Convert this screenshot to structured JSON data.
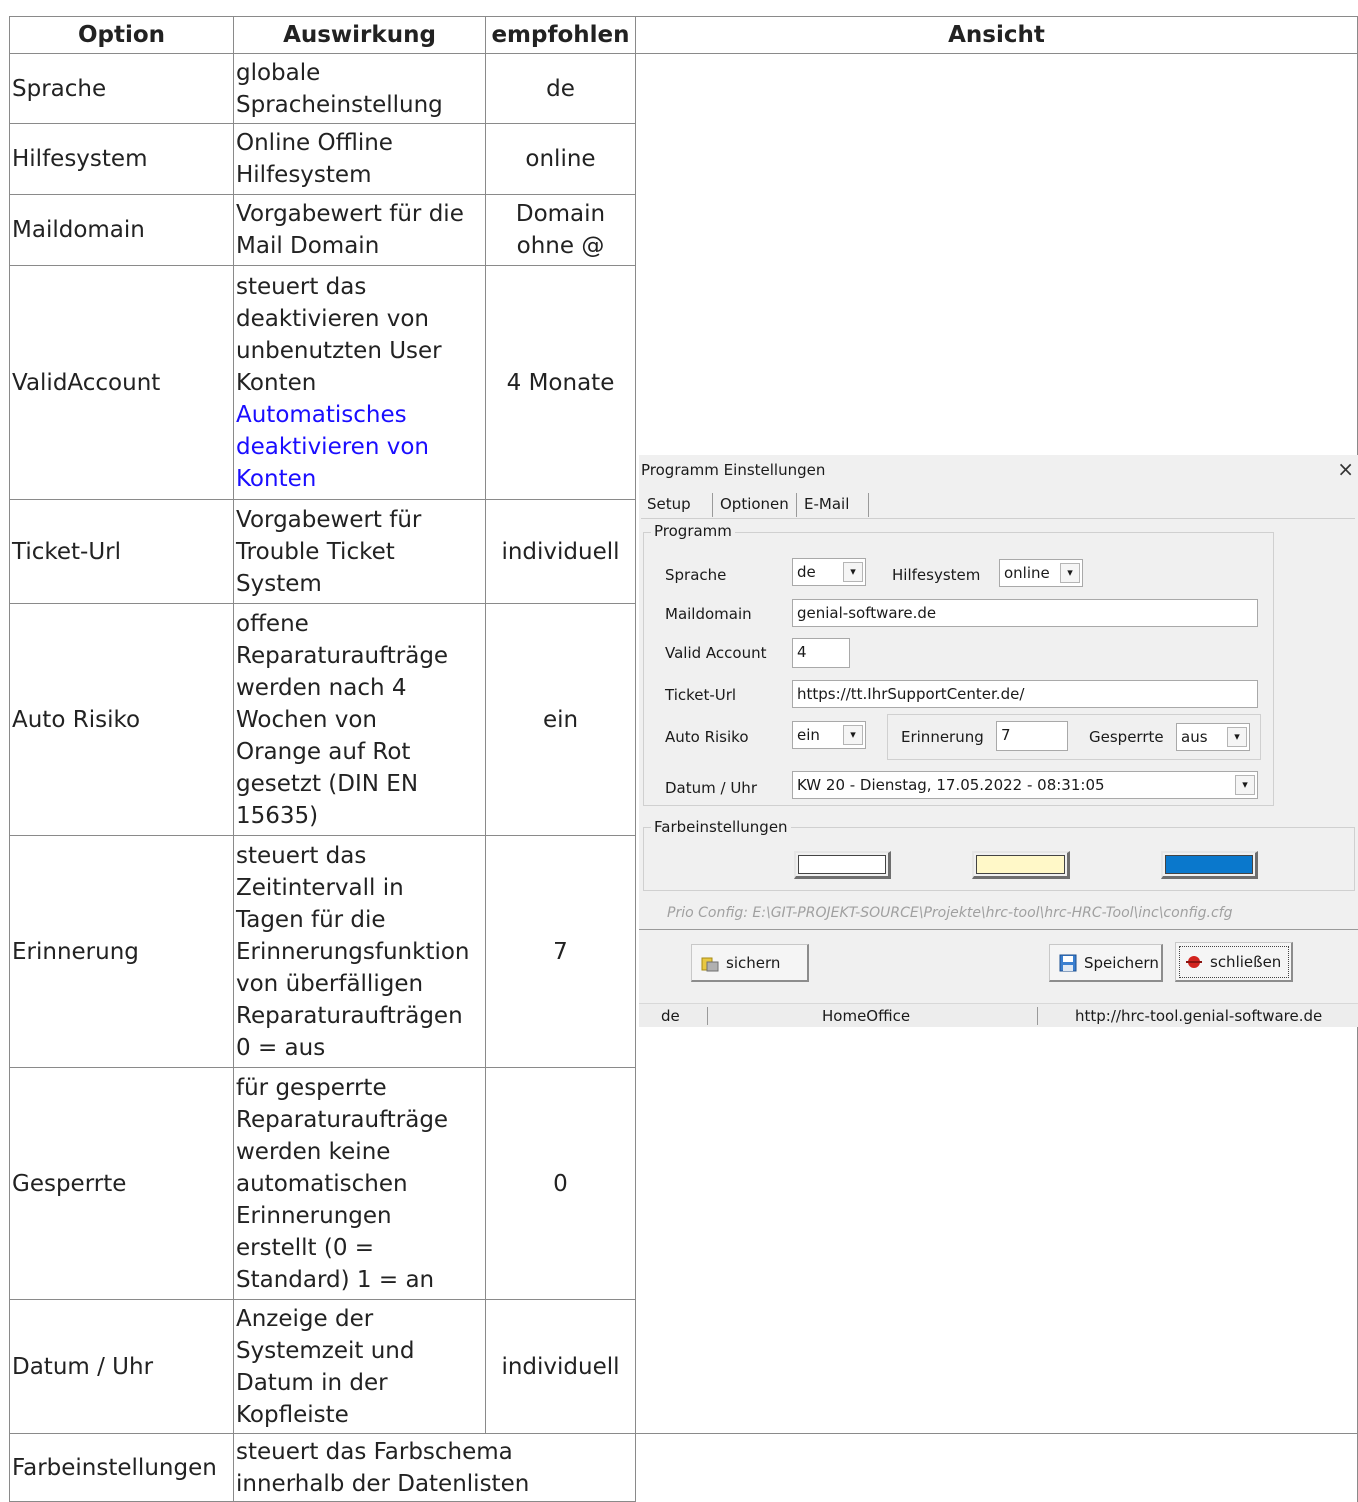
{
  "headers": [
    "Option",
    "Auswirkung",
    "empfohlen",
    "Ansicht"
  ],
  "rows": [
    {
      "option": "Sprache",
      "effect": [
        "globale",
        "Spracheinstellung"
      ],
      "recommended": [
        "de"
      ]
    },
    {
      "option": "Hilfesystem",
      "effect": [
        "Online Offline",
        "Hilfesystem"
      ],
      "recommended": [
        "online"
      ]
    },
    {
      "option": "Maildomain",
      "effect": [
        "Vorgabewert für die",
        "Mail Domain"
      ],
      "recommended": [
        "Domain",
        "ohne @"
      ]
    },
    {
      "option": "ValidAccount",
      "effect": [
        "steuert das",
        "deaktivieren von",
        "unbenutzten User",
        "Konten"
      ],
      "effect_link": [
        "Automatisches",
        "deaktivieren von",
        "Konten"
      ],
      "recommended": [
        "4 Monate"
      ]
    },
    {
      "option": "Ticket-Url",
      "effect": [
        "Vorgabewert für",
        "Trouble Ticket",
        "System"
      ],
      "recommended": [
        "individuell"
      ]
    },
    {
      "option": "Auto Risiko",
      "effect": [
        "offene",
        "Reparaturaufträge",
        "werden nach 4",
        "Wochen von",
        "Orange auf Rot",
        "gesetzt (DIN EN",
        "15635)"
      ],
      "recommended": [
        "ein"
      ]
    },
    {
      "option": "Erinnerung",
      "effect": [
        "steuert das",
        "Zeitintervall in",
        "Tagen für die",
        "Erinnerungsfunktion",
        "von überfälligen",
        "Reparaturaufträgen",
        "0 = aus"
      ],
      "recommended": [
        "7"
      ]
    },
    {
      "option": "Gesperrte",
      "effect": [
        "für gesperrte",
        "Reparaturaufträge",
        "werden keine",
        "automatischen",
        "Erinnerungen",
        "erstellt (0 =",
        "Standard) 1 = an"
      ],
      "recommended": [
        "0"
      ]
    },
    {
      "option": "Datum / Uhr",
      "effect": [
        "Anzeige der",
        "Systemzeit und",
        "Datum in der",
        "Kopfleiste"
      ],
      "recommended": [
        "individuell"
      ]
    },
    {
      "option": "Farbeinstellungen",
      "effect": [
        "steuert das Farbschema",
        "innerhalb der Datenlisten"
      ],
      "recommended": []
    }
  ],
  "dialog": {
    "title": "Programm Einstellungen",
    "close": "×",
    "tabs": [
      "Setup",
      "Optionen",
      "E-Mail"
    ],
    "group_program": "Programm",
    "labels": {
      "sprache": "Sprache",
      "hilfesystem": "Hilfesystem",
      "maildomain": "Maildomain",
      "valid_account": "Valid Account",
      "ticket_url": "Ticket-Url",
      "auto_risiko": "Auto Risiko",
      "erinnerung": "Erinnerung",
      "gesperrte": "Gesperrte",
      "datum_uhr": "Datum / Uhr"
    },
    "values": {
      "sprache": "de",
      "hilfesystem": "online",
      "maildomain": "genial-software.de",
      "valid_account": "4",
      "ticket_url": "https://tt.IhrSupportCenter.de/",
      "auto_risiko": "ein",
      "erinnerung": "7",
      "gesperrte": "aus",
      "datum_uhr": "KW 20 - Dienstag, 17.05.2022 - 08:31:05"
    },
    "combo_arrow": "▾",
    "group_colors": "Farbeinstellungen",
    "colors": [
      "#ffffff",
      "#fff8c8",
      "#0a78cc"
    ],
    "config_path": "Prio Config: E:\\GIT-PROJEKT-SOURCE\\Projekte\\hrc-tool\\hrc-HRC-Tool\\inc\\config.cfg",
    "buttons": {
      "backup": "sichern",
      "save": "Speichern",
      "close": "schließen"
    },
    "status": {
      "lang": "de",
      "location": "HomeOffice",
      "url": "http://hrc-tool.genial-software.de"
    }
  }
}
